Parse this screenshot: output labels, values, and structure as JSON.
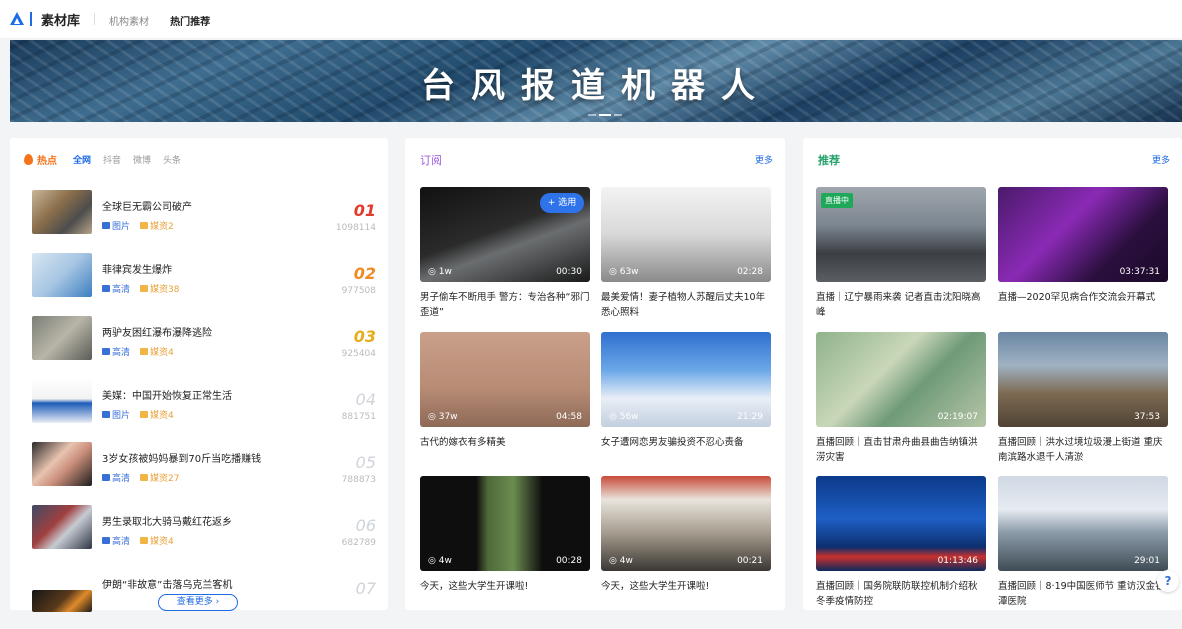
{
  "topbar": {
    "brand": "素材库",
    "nav": [
      "机构素材",
      "热门推荐"
    ]
  },
  "banner": {
    "title": "台风报道机器人"
  },
  "hot": {
    "title": "热点",
    "tabs": [
      "全网",
      "抖音",
      "微博",
      "头条"
    ],
    "items": [
      {
        "title": "全球巨无霸公司破产",
        "tag1": "图片",
        "tag2": "媒资2",
        "rank": "01",
        "views": "1098114"
      },
      {
        "title": "菲律宾发生爆炸",
        "tag1": "高清",
        "tag2": "媒资38",
        "rank": "02",
        "views": "977508"
      },
      {
        "title": "两驴友困红瀑布瀑降逃险",
        "tag1": "高清",
        "tag2": "媒资4",
        "rank": "03",
        "views": "925404"
      },
      {
        "title": "美媒：中国开始恢复正常生活",
        "tag1": "图片",
        "tag2": "媒资4",
        "rank": "04",
        "views": "881751"
      },
      {
        "title": "3岁女孩被妈妈暴到70斤当吃播赚钱",
        "tag1": "高清",
        "tag2": "媒资27",
        "rank": "05",
        "views": "788873"
      },
      {
        "title": "男生录取北大骑马戴红花返乡",
        "tag1": "高清",
        "tag2": "媒资4",
        "rank": "06",
        "views": "682789"
      },
      {
        "title": "伊朗“非故意”击落乌克兰客机",
        "rank": "07"
      }
    ],
    "more": "查看更多 ›"
  },
  "subscribe": {
    "title": "订阅",
    "more": "更多",
    "use_label": "+ 选用",
    "cards": [
      {
        "views": "1w",
        "duration": "00:30",
        "caption": "男子偷车不断甩手 警方：专治各种“邪门歪道”"
      },
      {
        "views": "63w",
        "duration": "02:28",
        "caption": "最美爱情！妻子植物人苏醒后丈夫10年悉心照料"
      },
      {
        "views": "37w",
        "duration": "04:58",
        "caption": "古代的嫁衣有多精美"
      },
      {
        "views": "56w",
        "duration": "21:29",
        "caption": "女子遭网恋男友骗投资不忍心责备"
      },
      {
        "views": "4w",
        "duration": "00:28",
        "caption": "今天，这些大学生开课啦!"
      },
      {
        "views": "4w",
        "duration": "00:21",
        "caption": "今天，这些大学生开课啦!"
      }
    ]
  },
  "recommend": {
    "title": "推荐",
    "more": "更多",
    "live_label": "直播中",
    "cards": [
      {
        "duration": "",
        "caption": "直播｜辽宁暴雨来袭 记者直击沈阳晓高峰"
      },
      {
        "duration": "03:37:31",
        "caption": "直播—2020罕见病合作交流会开幕式"
      },
      {
        "duration": "02:19:07",
        "caption": "直播回顾｜直击甘肃舟曲县曲告纳镇洪涝灾害"
      },
      {
        "duration": "37:53",
        "caption": "直播回顾｜洪水过境垃圾漫上街道 重庆南滨路水退千人清淤"
      },
      {
        "duration": "01:13:46",
        "caption": "直播回顾｜国务院联防联控机制介绍秋冬季疫情防控"
      },
      {
        "duration": "29:01",
        "caption": "直播回顾｜8·19中国医师节 重访汉金银潭医院"
      }
    ]
  },
  "help": "?"
}
